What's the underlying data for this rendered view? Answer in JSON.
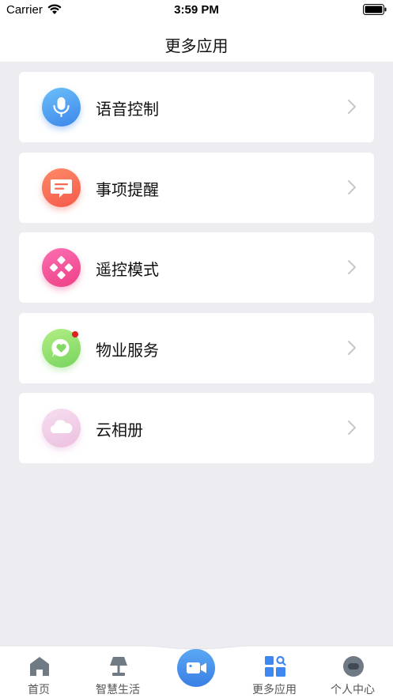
{
  "status_bar": {
    "carrier": "Carrier",
    "time": "3:59 PM"
  },
  "header": {
    "title": "更多应用"
  },
  "menu": {
    "items": [
      {
        "label": "语音控制",
        "icon": "microphone-icon",
        "color": "#4a9cf0"
      },
      {
        "label": "事项提醒",
        "icon": "message-icon",
        "color": "#fb6d55"
      },
      {
        "label": "遥控模式",
        "icon": "remote-control-icon",
        "color": "#f34d97"
      },
      {
        "label": "物业服务",
        "icon": "heart-chat-icon",
        "color": "#8fdf6c"
      },
      {
        "label": "云相册",
        "icon": "cloud-icon",
        "color": "#f2cbe6"
      }
    ]
  },
  "tab_bar": {
    "tabs": [
      {
        "label": "首页",
        "icon": "home-icon"
      },
      {
        "label": "智慧生活",
        "icon": "lamp-icon"
      },
      {
        "label": "",
        "icon": "video-camera-icon"
      },
      {
        "label": "更多应用",
        "icon": "apps-icon",
        "active": true
      },
      {
        "label": "个人中心",
        "icon": "profile-icon"
      }
    ]
  }
}
